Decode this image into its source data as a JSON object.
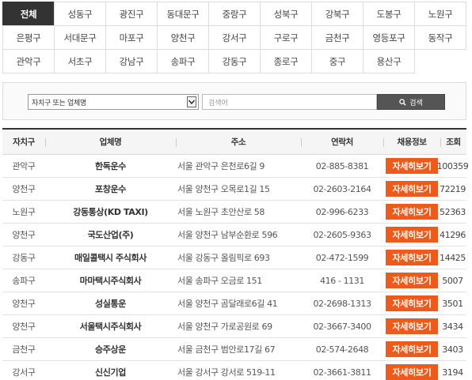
{
  "districts": [
    {
      "label": "전체",
      "active": true
    },
    {
      "label": "성동구"
    },
    {
      "label": "광진구"
    },
    {
      "label": "동대문구"
    },
    {
      "label": "중랑구"
    },
    {
      "label": "성북구"
    },
    {
      "label": "강북구"
    },
    {
      "label": "도봉구"
    },
    {
      "label": "노원구"
    },
    {
      "label": "은평구"
    },
    {
      "label": "서대문구"
    },
    {
      "label": "마포구"
    },
    {
      "label": "양천구"
    },
    {
      "label": "강서구"
    },
    {
      "label": "구로구"
    },
    {
      "label": "금천구"
    },
    {
      "label": "영등포구"
    },
    {
      "label": "동작구"
    },
    {
      "label": "관악구"
    },
    {
      "label": "서초구"
    },
    {
      "label": "강남구"
    },
    {
      "label": "송파구"
    },
    {
      "label": "강동구"
    },
    {
      "label": "종로구"
    },
    {
      "label": "중구"
    },
    {
      "label": "용산구"
    }
  ],
  "search": {
    "select_value": "자치구 또는 업체명",
    "input_placeholder": "검색어",
    "button_label": "검색",
    "button_icon": "search-icon"
  },
  "table": {
    "headers": {
      "district": "자치구",
      "company": "업체명",
      "address": "주소",
      "contact": "연락처",
      "jobs": "채용정보",
      "views": "조회"
    },
    "rows": [
      {
        "district": "관악구",
        "company": "한독운수",
        "address": "서울 관악구 은천로6길 9",
        "contact": "02-885-8381",
        "jobs": "자세히보기",
        "views": "100359"
      },
      {
        "district": "양천구",
        "company": "포창운수",
        "address": "서울 양천구 오목로1길 15",
        "contact": "02-2603-2164",
        "jobs": "자세히보기",
        "views": "72219"
      },
      {
        "district": "노원구",
        "company": "강동통상(KD TAXI)",
        "address": "서울 노원구 초안산로 58",
        "contact": "02-996-6233",
        "jobs": "자세히보기",
        "views": "52363"
      },
      {
        "district": "양천구",
        "company": "국도산업(주)",
        "address": "서울 양천구 남부순환로 596",
        "contact": "02-2605-9363",
        "jobs": "자세히보기",
        "views": "41296"
      },
      {
        "district": "강동구",
        "company": "매일콜택시 주식회사",
        "address": "서울 강동구 올림픽로 693",
        "contact": "02-472-1599",
        "jobs": "자세히보기",
        "views": "14425"
      },
      {
        "district": "송파구",
        "company": "마마택시주식회사",
        "address": "서울 송파구 오금로 151",
        "contact": "416 - 1131",
        "jobs": "자세히보기",
        "views": "5007"
      },
      {
        "district": "양천구",
        "company": "성실통운",
        "address": "서울 양천구 곰달래로6길 41",
        "contact": "02-2698-1313",
        "jobs": "자세히보기",
        "views": "3501"
      },
      {
        "district": "양천구",
        "company": "서울택시주식회사",
        "address": "서울 양천구 가로공원로 69",
        "contact": "02-3667-3400",
        "jobs": "자세히보기",
        "views": "3434"
      },
      {
        "district": "금천구",
        "company": "승주상운",
        "address": "서울 금천구 범안로17길 67",
        "contact": "02-574-2648",
        "jobs": "자세히보기",
        "views": "3403"
      },
      {
        "district": "강서구",
        "company": "신신기업",
        "address": "서울 강서구 강서로 519-11",
        "contact": "02-3661-3811",
        "jobs": "자세히보기",
        "views": "3194"
      }
    ]
  },
  "colors": {
    "active_tab": "#333333",
    "detail_button": "#ee5a1c",
    "search_button": "#555555"
  }
}
